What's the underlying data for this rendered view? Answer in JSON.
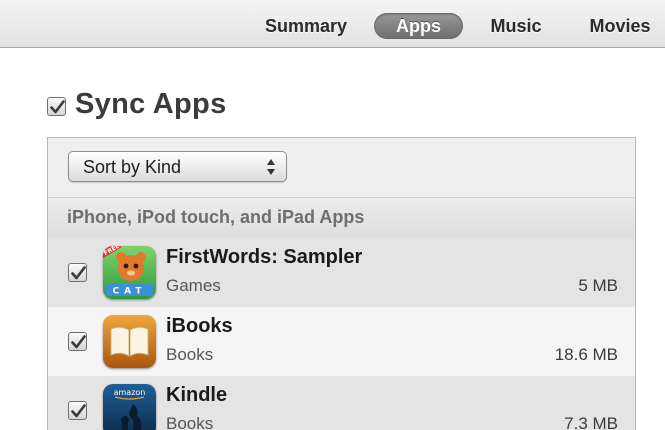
{
  "tabs": [
    {
      "label": "Summary",
      "selected": false
    },
    {
      "label": "Apps",
      "selected": true
    },
    {
      "label": "Music",
      "selected": false
    },
    {
      "label": "Movies",
      "selected": false
    }
  ],
  "sync": {
    "label": "Sync Apps",
    "checked": true
  },
  "sort": {
    "selected": "Sort by Kind"
  },
  "section": {
    "title": "iPhone, iPod touch, and iPad Apps"
  },
  "apps": [
    {
      "name": "FirstWords: Sampler",
      "category": "Games",
      "size": "5 MB",
      "checked": true,
      "icon": "firstwords-app-icon"
    },
    {
      "name": "iBooks",
      "category": "Books",
      "size": "18.6 MB",
      "checked": true,
      "icon": "ibooks-app-icon"
    },
    {
      "name": "Kindle",
      "category": "Books",
      "size": "7.3 MB",
      "checked": true,
      "icon": "kindle-app-icon"
    }
  ],
  "icon_text": {
    "firstwords_tag": "FREE",
    "firstwords_word": "CAT",
    "kindle_brand": "amazon"
  },
  "colors": {
    "selected_tab": "#7d7d7d",
    "checkmark": "#3a3a3a",
    "panel_bg": "#efefef"
  }
}
